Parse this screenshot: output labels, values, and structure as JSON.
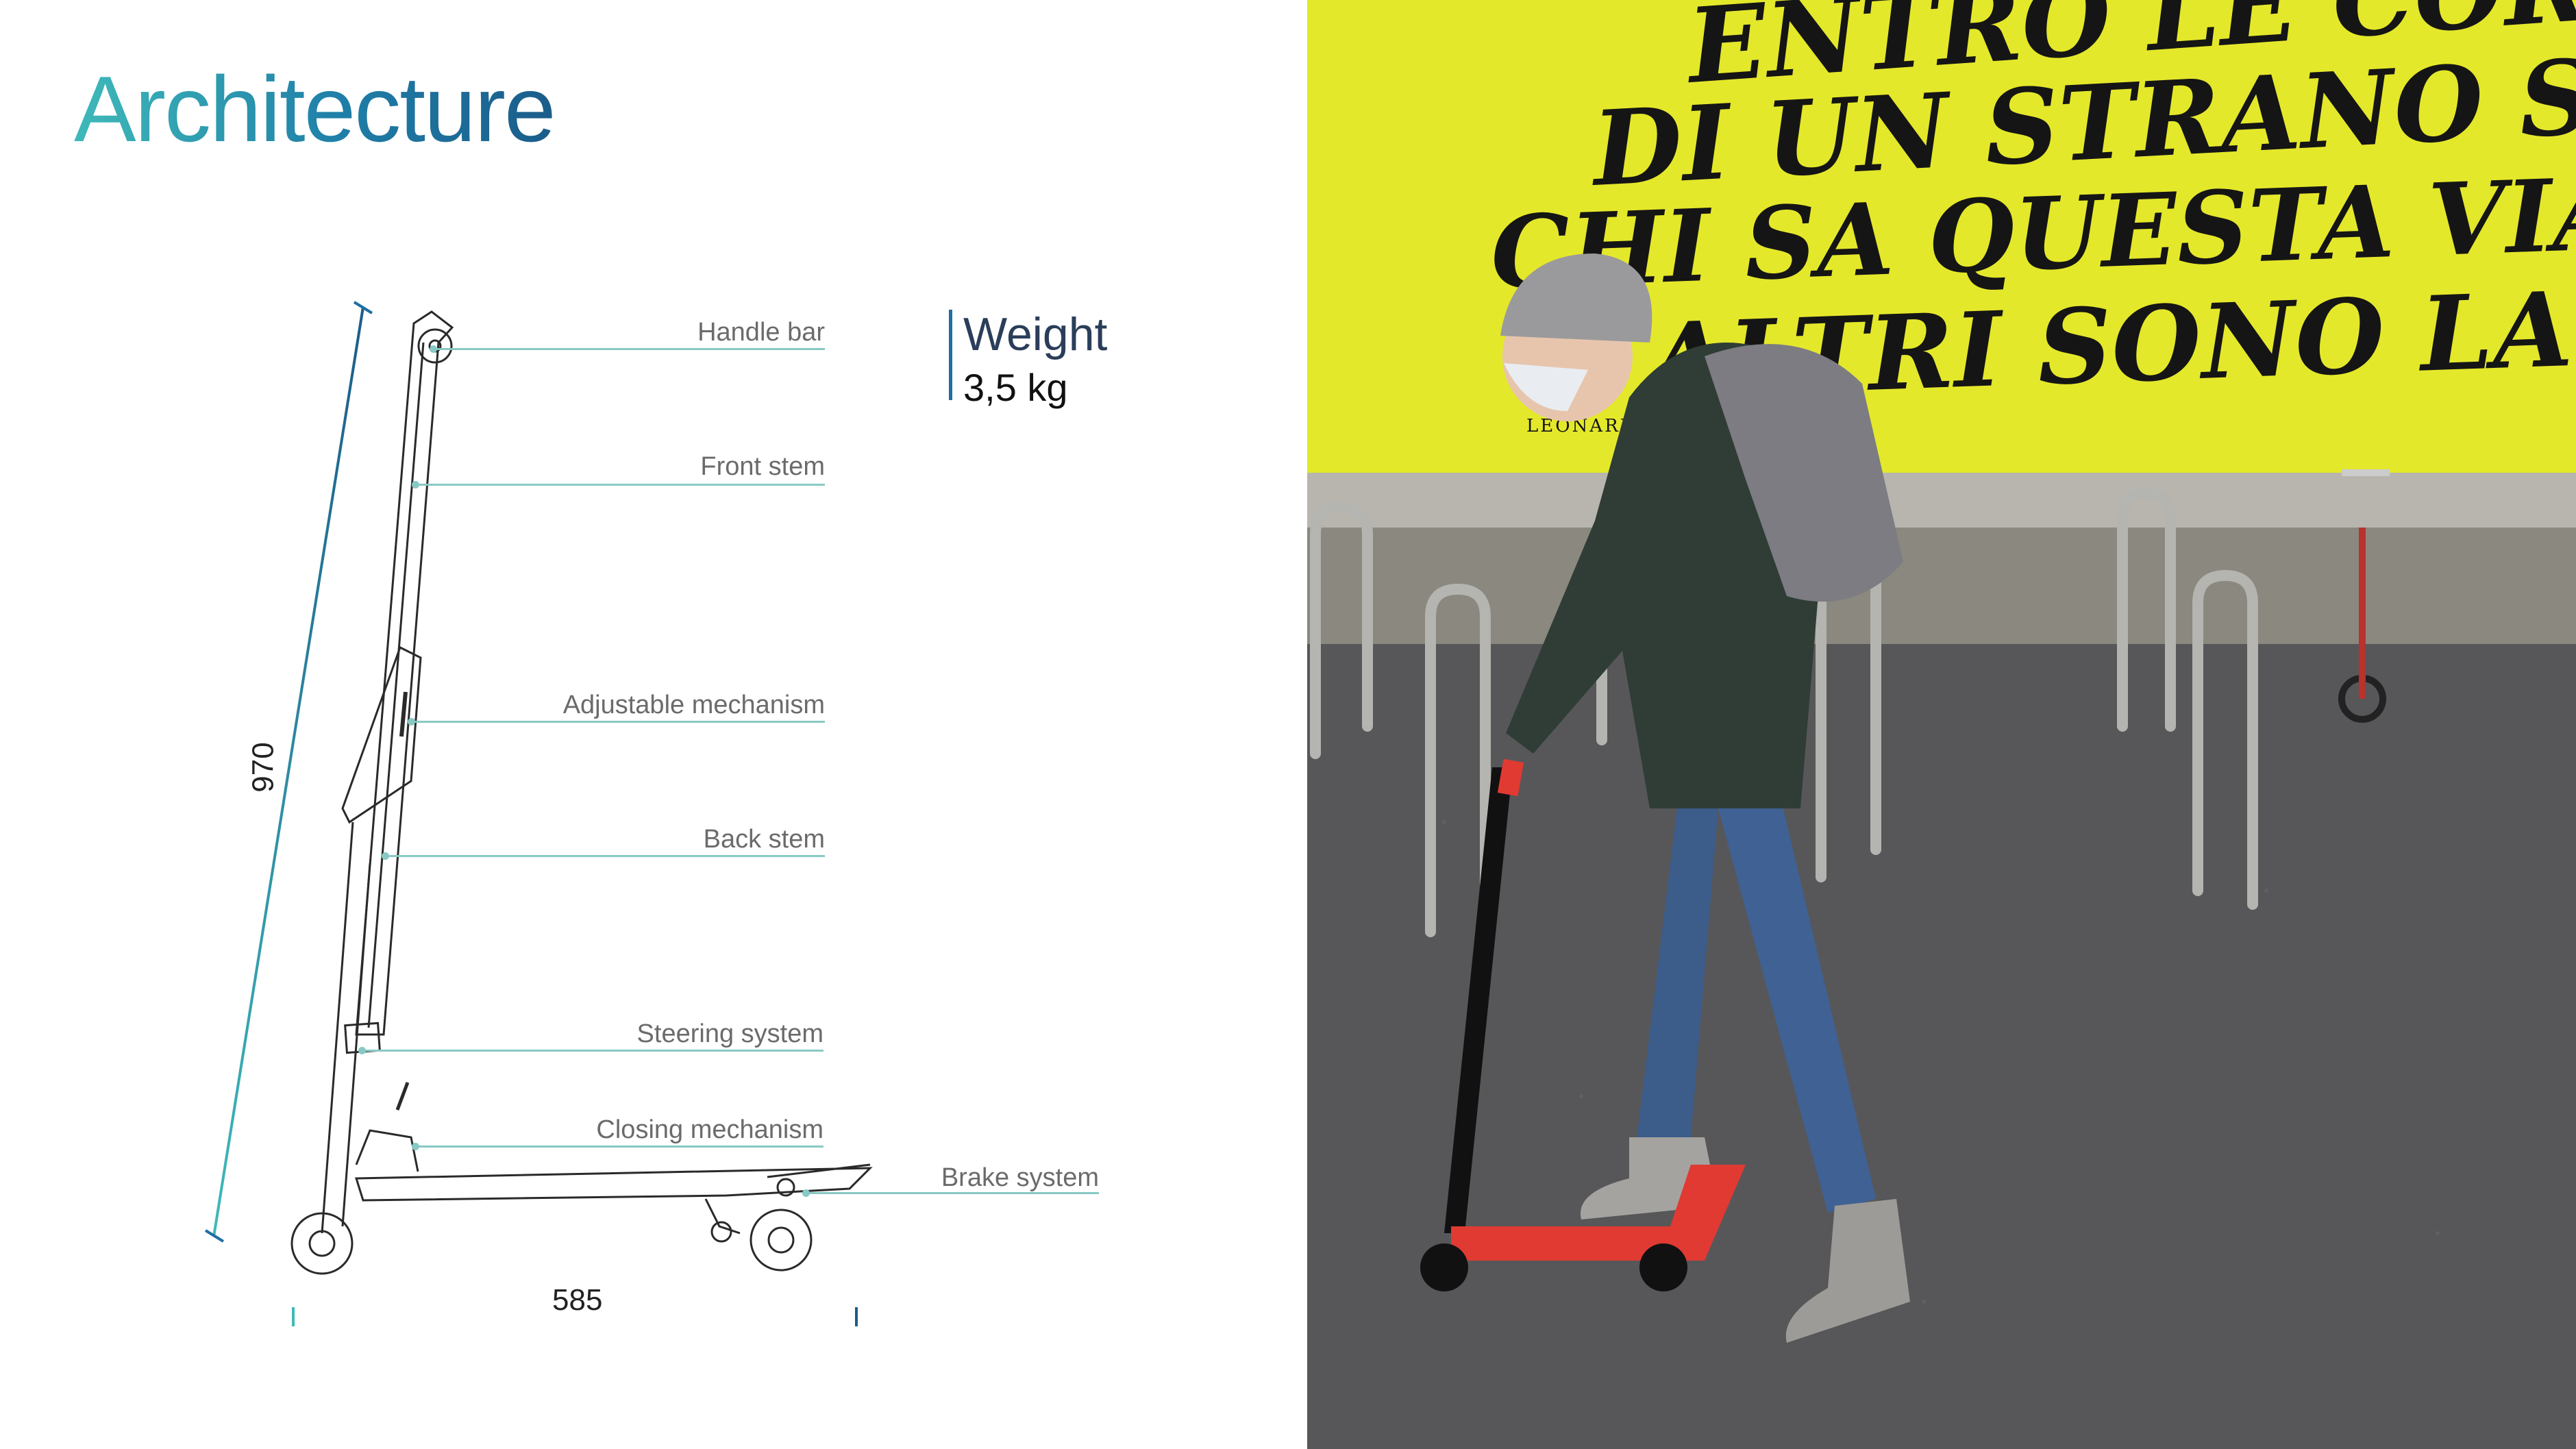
{
  "title": "Architecture",
  "parts": {
    "handle_bar": "Handle bar",
    "front_stem": "Front stem",
    "adjustable_mechanism": "Adjustable mechanism",
    "back_stem": "Back stem",
    "steering_system": "Steering system",
    "closing_mechanism": "Closing mechanism",
    "brake_system": "Brake system"
  },
  "weight": {
    "label": "Weight",
    "value": "3,5 kg"
  },
  "dimensions": {
    "height": "970",
    "length": "585"
  },
  "mural": {
    "line1": "ENTRO LE CORNICE",
    "line2": "DI UN STRANO SWERC",
    "line3": "CHI SA QUESTA VIA DA GRAND",
    "line4": "ALTRI SONO LA SETT",
    "signature": "LEONARDO"
  },
  "colors": {
    "accent_teal": "#3fb9b9",
    "accent_blue": "#1f6ea3",
    "leader_line": "#88c9c4",
    "wall_yellow": "#e4e82a",
    "scooter_red": "#e03a32"
  }
}
